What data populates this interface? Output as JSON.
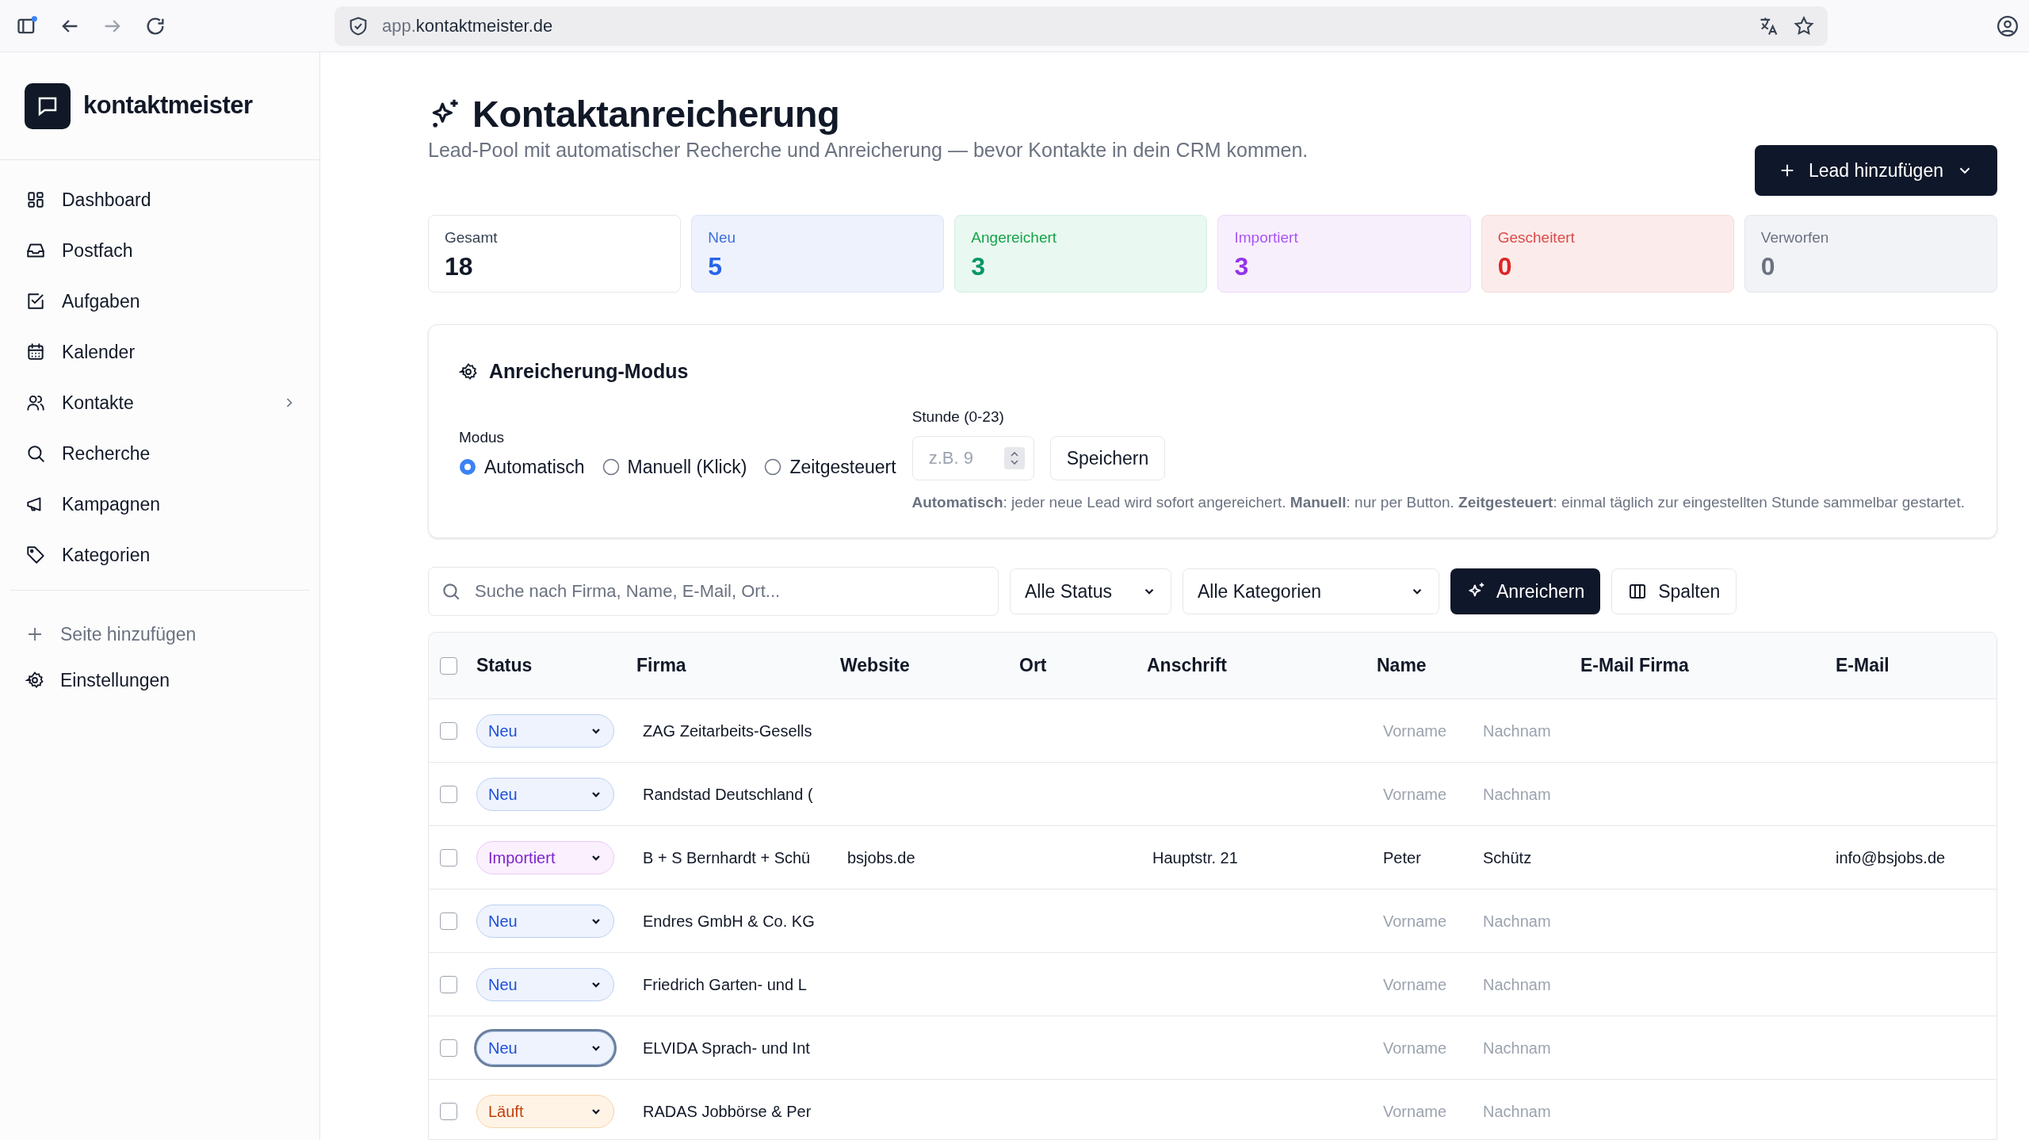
{
  "browser": {
    "url_subdomain": "app.",
    "url_domain": "kontaktmeister.de"
  },
  "sidebar": {
    "brand": "kontaktmeister",
    "items": [
      {
        "label": "Dashboard",
        "has_submenu": false
      },
      {
        "label": "Postfach",
        "has_submenu": false
      },
      {
        "label": "Aufgaben",
        "has_submenu": false
      },
      {
        "label": "Kalender",
        "has_submenu": false
      },
      {
        "label": "Kontakte",
        "has_submenu": true
      },
      {
        "label": "Recherche",
        "has_submenu": false
      },
      {
        "label": "Kampagnen",
        "has_submenu": false
      },
      {
        "label": "Kategorien",
        "has_submenu": false
      }
    ],
    "add_page": "Seite hinzufügen",
    "settings": "Einstellungen"
  },
  "header": {
    "title": "Kontaktanreicherung",
    "subtitle": "Lead-Pool mit automatischer Recherche und Anreicherung — bevor Kontakte in dein CRM kommen.",
    "add_button": "Lead hinzufügen"
  },
  "stats": [
    {
      "kind": "total",
      "label": "Gesamt",
      "value": "18"
    },
    {
      "kind": "new",
      "label": "Neu",
      "value": "5"
    },
    {
      "kind": "enriched",
      "label": "Angereichert",
      "value": "3"
    },
    {
      "kind": "imported",
      "label": "Importiert",
      "value": "3"
    },
    {
      "kind": "failed",
      "label": "Gescheitert",
      "value": "0"
    },
    {
      "kind": "discarded",
      "label": "Verworfen",
      "value": "0"
    }
  ],
  "mode_panel": {
    "title": "Anreicherung-Modus",
    "mode_label": "Modus",
    "modes": [
      {
        "label": "Automatisch",
        "selected": true
      },
      {
        "label": "Manuell (Klick)",
        "selected": false
      },
      {
        "label": "Zeitgesteuert",
        "selected": false
      }
    ],
    "hour_label": "Stunde (0-23)",
    "hour_placeholder": "z.B. 9",
    "save_button": "Speichern",
    "hint": "**Automatisch**: jeder neue Lead wird sofort angereichert. **Manuell**: nur per Button. **Zeitgesteuert**: einmal täglich zur eingestellten Stunde sammelbar gestartet."
  },
  "toolbar": {
    "search_placeholder": "Suche nach Firma, Name, E-Mail, Ort...",
    "status_filter": "Alle Status",
    "category_filter": "Alle Kategorien",
    "enrich_button": "Anreichern",
    "columns_button": "Spalten"
  },
  "table": {
    "columns": [
      "Status",
      "Firma",
      "Website",
      "Ort",
      "Anschrift",
      "Name",
      "E-Mail Firma",
      "E-Mail"
    ],
    "all_checked": false,
    "rows": [
      {
        "checked": false,
        "status": {
          "kind": "new",
          "label": "Neu"
        },
        "focused": false,
        "firma": "ZAG Zeitarbeits-Gesells",
        "first_name": {
          "placeholder": "Vorname"
        },
        "last_name": {
          "placeholder": "Nachnam"
        }
      },
      {
        "checked": false,
        "status": {
          "kind": "new",
          "label": "Neu"
        },
        "focused": false,
        "firma": "Randstad Deutschland (",
        "first_name": {
          "placeholder": "Vorname"
        },
        "last_name": {
          "placeholder": "Nachnam"
        }
      },
      {
        "checked": false,
        "status": {
          "kind": "imported",
          "label": "Importiert"
        },
        "focused": false,
        "firma": "B + S Bernhardt + Schü",
        "website": "bsjobs.de",
        "anschrift": "Hauptstr. 21",
        "first_name": {
          "value": "Peter"
        },
        "last_name": {
          "value": "Schütz"
        },
        "email": "info@bsjobs.de"
      },
      {
        "checked": false,
        "status": {
          "kind": "new",
          "label": "Neu"
        },
        "focused": false,
        "firma": "Endres GmbH & Co. KG",
        "first_name": {
          "placeholder": "Vorname"
        },
        "last_name": {
          "placeholder": "Nachnam"
        }
      },
      {
        "checked": false,
        "status": {
          "kind": "new",
          "label": "Neu"
        },
        "focused": false,
        "firma": "Friedrich Garten- und L",
        "first_name": {
          "placeholder": "Vorname"
        },
        "last_name": {
          "placeholder": "Nachnam"
        }
      },
      {
        "checked": false,
        "status": {
          "kind": "new",
          "label": "Neu"
        },
        "focused": true,
        "firma": "ELVIDA Sprach- und Int",
        "first_name": {
          "placeholder": "Vorname"
        },
        "last_name": {
          "placeholder": "Nachnam"
        }
      },
      {
        "checked": false,
        "status": {
          "kind": "running",
          "label": "Läuft"
        },
        "focused": false,
        "firma": "RADAS Jobbörse & Per",
        "first_name": {
          "placeholder": "Vorname"
        },
        "last_name": {
          "placeholder": "Nachnam"
        }
      }
    ]
  }
}
